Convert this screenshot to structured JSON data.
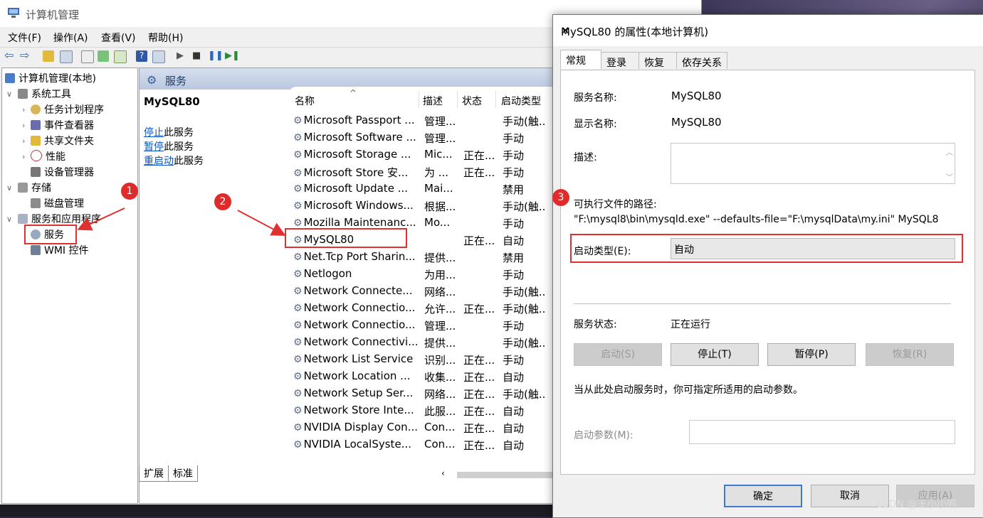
{
  "window": {
    "title": "计算机管理",
    "min": "—",
    "max": "☐",
    "close": "✕"
  },
  "menu": [
    "文件(F)",
    "操作(A)",
    "查看(V)",
    "帮助(H)"
  ],
  "tree": {
    "root": "计算机管理(本地)",
    "system_tools": "系统工具",
    "task_scheduler": "任务计划程序",
    "event_viewer": "事件查看器",
    "shared_folders": "共享文件夹",
    "performance": "性能",
    "device_manager": "设备管理器",
    "storage": "存储",
    "disk_management": "磁盘管理",
    "services_apps": "服务和应用程序",
    "services": "服务",
    "wmi": "WMI 控件"
  },
  "services_pane": {
    "header": "服务",
    "selected_name": "MySQL80",
    "link_stop": "停止",
    "link_stop_suffix": "此服务",
    "link_pause": "暂停",
    "link_pause_suffix": "此服务",
    "link_restart": "重启动",
    "link_restart_suffix": "此服务",
    "columns": {
      "name": "名称",
      "desc": "描述",
      "status": "状态",
      "startup": "启动类型",
      "sort": "^"
    },
    "rows": [
      {
        "name": "Microsoft Passport ...",
        "desc": "管理...",
        "status": "",
        "startup": "手动(触..."
      },
      {
        "name": "Microsoft Software ...",
        "desc": "管理...",
        "status": "",
        "startup": "手动"
      },
      {
        "name": "Microsoft Storage ...",
        "desc": "Mic...",
        "status": "正在...",
        "startup": "手动"
      },
      {
        "name": "Microsoft Store 安...",
        "desc": "为 ...",
        "status": "正在...",
        "startup": "手动"
      },
      {
        "name": "Microsoft Update ...",
        "desc": "Mai...",
        "status": "",
        "startup": "禁用"
      },
      {
        "name": "Microsoft Windows...",
        "desc": "根据...",
        "status": "",
        "startup": "手动(触..."
      },
      {
        "name": "Mozilla Maintenanc...",
        "desc": "Mo...",
        "status": "",
        "startup": "手动"
      },
      {
        "name": "MySQL80",
        "desc": "",
        "status": "正在...",
        "startup": "自动"
      },
      {
        "name": "Net.Tcp Port Sharin...",
        "desc": "提供...",
        "status": "",
        "startup": "禁用"
      },
      {
        "name": "Netlogon",
        "desc": "为用...",
        "status": "",
        "startup": "手动"
      },
      {
        "name": "Network Connecte...",
        "desc": "网络...",
        "status": "",
        "startup": "手动(触..."
      },
      {
        "name": "Network Connectio...",
        "desc": "允许...",
        "status": "正在...",
        "startup": "手动(触..."
      },
      {
        "name": "Network Connectio...",
        "desc": "管理...",
        "status": "",
        "startup": "手动"
      },
      {
        "name": "Network Connectivi...",
        "desc": "提供...",
        "status": "",
        "startup": "手动(触..."
      },
      {
        "name": "Network List Service",
        "desc": "识别...",
        "status": "正在...",
        "startup": "手动"
      },
      {
        "name": "Network Location ...",
        "desc": "收集...",
        "status": "正在...",
        "startup": "自动"
      },
      {
        "name": "Network Setup Ser...",
        "desc": "网络...",
        "status": "正在...",
        "startup": "手动(触..."
      },
      {
        "name": "Network Store Inte...",
        "desc": "此服...",
        "status": "正在...",
        "startup": "自动"
      },
      {
        "name": "NVIDIA Display Con...",
        "desc": "Con...",
        "status": "正在...",
        "startup": "自动"
      },
      {
        "name": "NVIDIA LocalSyste...",
        "desc": "Con...",
        "status": "正在...",
        "startup": "自动"
      }
    ],
    "bottom_tabs": [
      "扩展",
      "标准"
    ]
  },
  "annotations": {
    "badge1": "1",
    "badge2": "2",
    "badge3": "3",
    "color": "#e03030"
  },
  "dialog": {
    "title": "MySQL80 的属性(本地计算机)",
    "close": "✕",
    "tabs": [
      "常规",
      "登录",
      "恢复",
      "依存关系"
    ],
    "service_name_label": "服务名称:",
    "service_name": "MySQL80",
    "display_name_label": "显示名称:",
    "display_name": "MySQL80",
    "description_label": "描述:",
    "path_label": "可执行文件的路径:",
    "path": "\"F:\\mysql8\\bin\\mysqld.exe\" --defaults-file=\"F:\\mysqlData\\my.ini\" MySQL8",
    "startup_label": "启动类型(E):",
    "startup_value": "自动",
    "status_label": "服务状态:",
    "status_value": "正在运行",
    "btn_start": "启动(S)",
    "btn_stop": "停止(T)",
    "btn_pause": "暂停(P)",
    "btn_resume": "恢复(R)",
    "hint": "当从此处启动服务时，你可指定所适用的启动参数。",
    "param_label": "启动参数(M):",
    "param_value": "",
    "ok": "确定",
    "cancel": "取消",
    "apply": "应用(A)"
  },
  "watermark": "CSDN @王小小鸭"
}
